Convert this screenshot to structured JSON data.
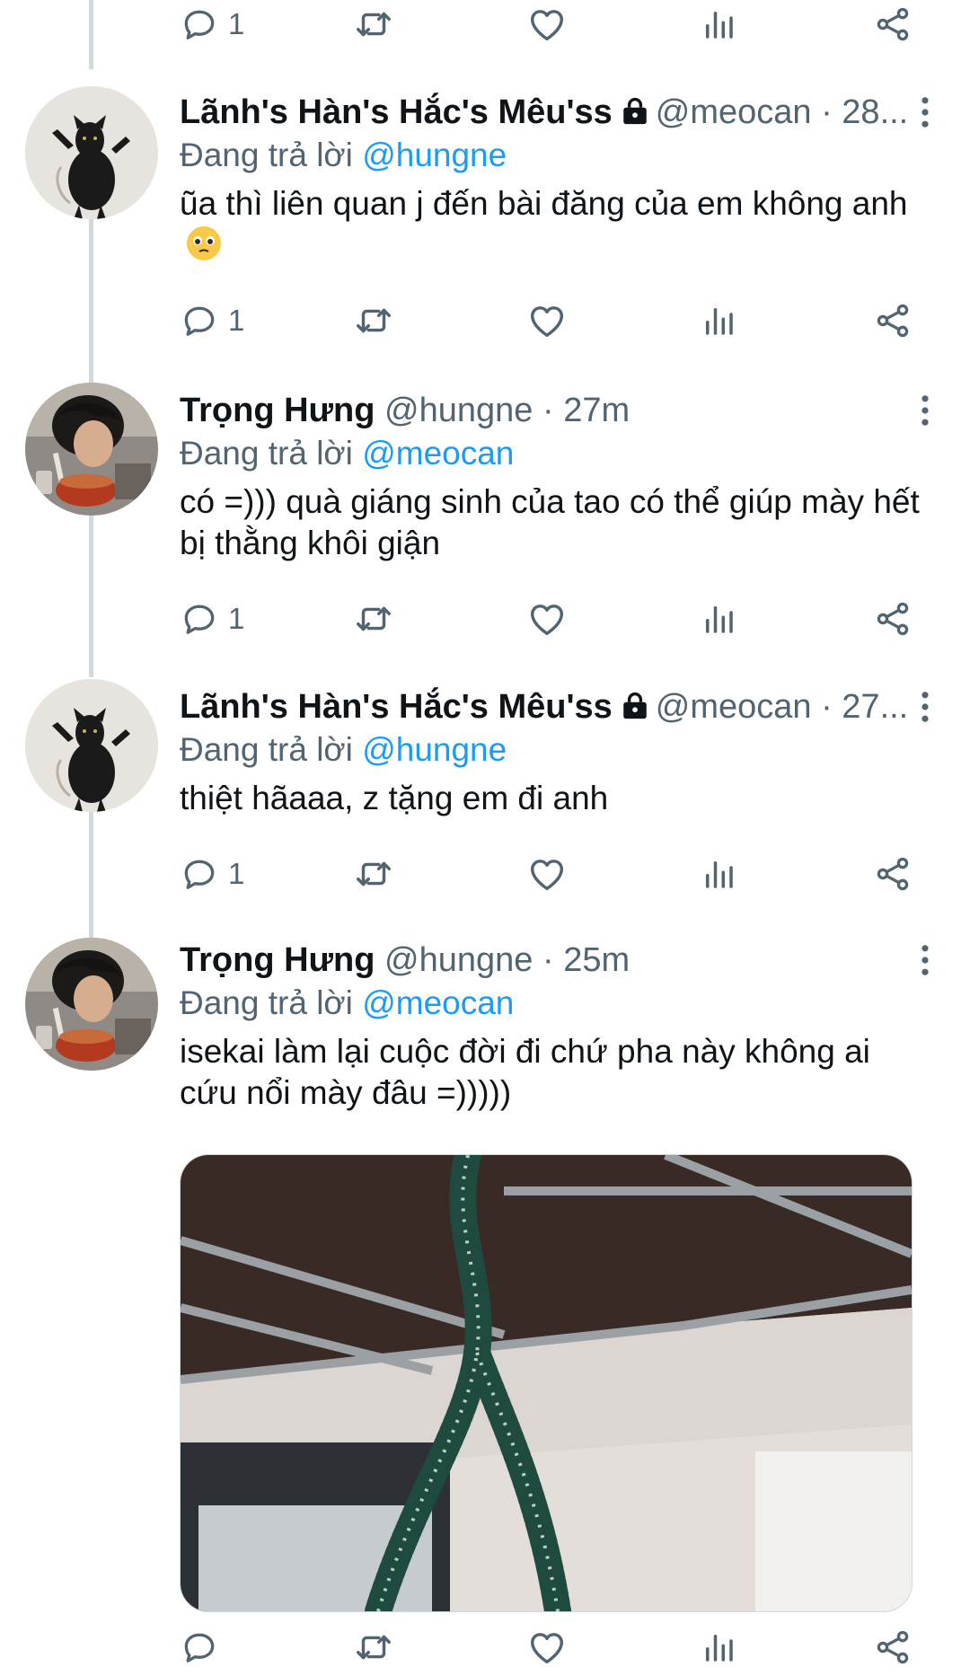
{
  "top_actions": {
    "reply_count": "1"
  },
  "tweets": [
    {
      "name": "Lãnh's Hàn's Hắc's Mêu'ss",
      "handle": "@meocan · 28...",
      "reply_prefix": "Đang trả lời",
      "reply_to": "@hungne",
      "text": "ũa thì liên quan j đến bài đăng của em không anh",
      "emoji": "pleading-face-emoji",
      "reply_count": "1",
      "locked": true
    },
    {
      "name": "Trọng Hưng",
      "handle": "@hungne · 27m",
      "reply_prefix": "Đang trả lời",
      "reply_to": "@meocan",
      "text": "có =))) quà giáng sinh của tao có thể giúp mày hết bị thằng khôi giận",
      "reply_count": "1",
      "locked": false
    },
    {
      "name": "Lãnh's Hàn's Hắc's Mêu'ss",
      "handle": "@meocan · 27...",
      "reply_prefix": "Đang trả lời",
      "reply_to": "@hungne",
      "text": "thiệt hãaaa, z tặng em đi anh",
      "reply_count": "1",
      "locked": true
    },
    {
      "name": "Trọng Hưng",
      "handle": "@hungne · 25m",
      "reply_prefix": "Đang trả lời",
      "reply_to": "@meocan",
      "text": "isekai làm lại cuộc đời đi chứ pha này không ai cứu nổi mày đâu =)))))",
      "reply_count": "",
      "locked": false
    }
  ],
  "icons": {
    "reply": "reply-icon",
    "retweet": "retweet-icon",
    "like": "like-icon",
    "views": "views-icon",
    "share": "share-icon",
    "more": "more-icon",
    "lock": "lock-icon"
  },
  "colors": {
    "text": "#0f1419",
    "muted": "#536471",
    "mention": "#1d9bf0",
    "thread_line": "#cfd9de"
  }
}
